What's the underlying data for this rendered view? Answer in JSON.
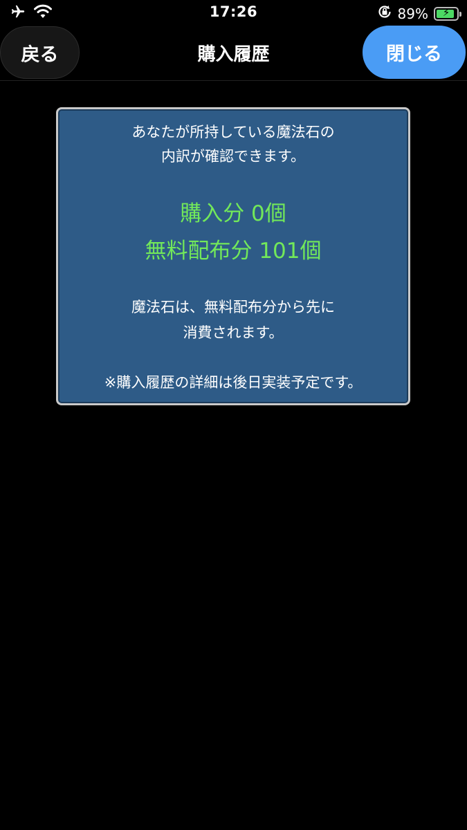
{
  "status_bar": {
    "time": "17:26",
    "battery_percent_label": "89%",
    "battery_level": 0.89,
    "icons": [
      "airplane-icon",
      "wifi-icon",
      "orientation-lock-icon",
      "battery-charging-icon"
    ]
  },
  "nav": {
    "back_label": "戻る",
    "title": "購入履歴",
    "close_label": "閉じる",
    "close_color": "#4a9cf5"
  },
  "panel": {
    "intro_lines": [
      "あなたが所持している魔法石の",
      "内訳が確認できます。"
    ],
    "purchased_line": "購入分 0個",
    "free_line": "無料配布分 101個",
    "highlight_color": "#72e85a",
    "note_lines": [
      "魔法石は、無料配布分から先に",
      "消費されます。"
    ],
    "footnote": "※購入履歴の詳細は後日実装予定です。",
    "background_color": "#2e5b87"
  }
}
